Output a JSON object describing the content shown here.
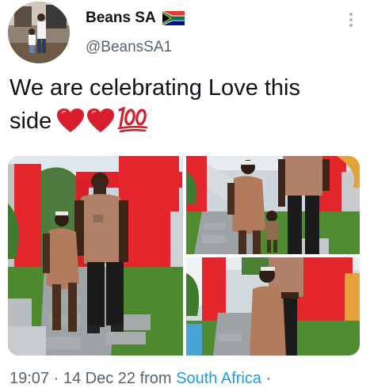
{
  "author": {
    "name": "Beans SA",
    "handle": "@BeansSA1",
    "flag_icon": "south-africa-flag-icon"
  },
  "tweet": {
    "line1": "We are celebrating Love this",
    "line2": "side",
    "emojis": [
      "red-heart-icon",
      "red-heart-icon",
      "hundred-points-icon"
    ]
  },
  "meta": {
    "time": "19:07",
    "sep1": "·",
    "date": "14 Dec 22",
    "from_label": "from",
    "source": "South Africa",
    "sep2": "·"
  },
  "colors": {
    "text": "#0f1419",
    "muted": "#536471",
    "link": "#1d9bf0",
    "heart": "#d81e2c"
  }
}
